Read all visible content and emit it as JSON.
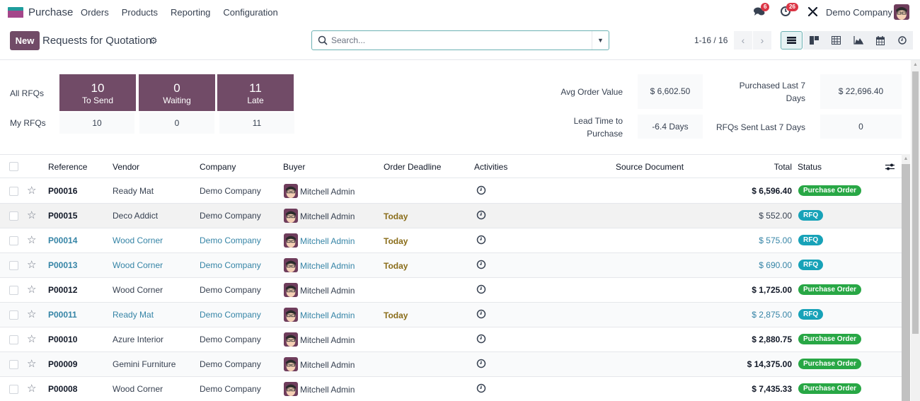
{
  "app": {
    "name": "Purchase",
    "menu": [
      "Orders",
      "Products",
      "Reporting",
      "Configuration"
    ]
  },
  "systray": {
    "messages_count": "6",
    "activities_count": "26",
    "company": "Demo Company",
    "user_avatar": "Mitchell Admin avatar"
  },
  "control": {
    "new_label": "New",
    "title": "Requests for Quotation",
    "search_placeholder": "Search...",
    "pager": "1-16 / 16",
    "views": [
      "list",
      "kanban",
      "pivot",
      "graph",
      "calendar",
      "activity"
    ],
    "active_view": "list"
  },
  "dashboard": {
    "row_labels": [
      "All RFQs",
      "My RFQs"
    ],
    "tiles": [
      {
        "count": "10",
        "label": "To Send",
        "mine": "10"
      },
      {
        "count": "0",
        "label": "Waiting",
        "mine": "0"
      },
      {
        "count": "11",
        "label": "Late",
        "mine": "11"
      }
    ],
    "kpis": {
      "avg_order_value_label": "Avg Order Value",
      "avg_order_value": "$ 6,602.50",
      "lead_time_label_1": "Lead Time to",
      "lead_time_label_2": "Purchase",
      "lead_time": "-6.4 Days",
      "purchased_label_1": "Purchased Last 7",
      "purchased_label_2": "Days",
      "purchased": "$ 22,696.40",
      "rfqs_sent_label": "RFQs Sent Last 7 Days",
      "rfqs_sent": "0"
    }
  },
  "table": {
    "columns": [
      "Reference",
      "Vendor",
      "Company",
      "Buyer",
      "Order Deadline",
      "Activities",
      "Source Document",
      "Total",
      "Status"
    ],
    "rows": [
      {
        "ref": "P00016",
        "vendor": "Ready Mat",
        "company": "Demo Company",
        "buyer": "Mitchell Admin",
        "deadline": "",
        "source": "",
        "total": "$ 6,596.40",
        "status": "Purchase Order"
      },
      {
        "ref": "P00015",
        "vendor": "Deco Addict",
        "company": "Demo Company",
        "buyer": "Mitchell Admin",
        "deadline": "Today",
        "source": "",
        "total": "$ 552.00",
        "status": "RFQ"
      },
      {
        "ref": "P00014",
        "vendor": "Wood Corner",
        "company": "Demo Company",
        "buyer": "Mitchell Admin",
        "deadline": "Today",
        "source": "",
        "total": "$ 575.00",
        "status": "RFQ"
      },
      {
        "ref": "P00013",
        "vendor": "Wood Corner",
        "company": "Demo Company",
        "buyer": "Mitchell Admin",
        "deadline": "Today",
        "source": "",
        "total": "$ 690.00",
        "status": "RFQ"
      },
      {
        "ref": "P00012",
        "vendor": "Wood Corner",
        "company": "Demo Company",
        "buyer": "Mitchell Admin",
        "deadline": "",
        "source": "",
        "total": "$ 1,725.00",
        "status": "Purchase Order"
      },
      {
        "ref": "P00011",
        "vendor": "Ready Mat",
        "company": "Demo Company",
        "buyer": "Mitchell Admin",
        "deadline": "Today",
        "source": "",
        "total": "$ 2,875.00",
        "status": "RFQ"
      },
      {
        "ref": "P00010",
        "vendor": "Azure Interior",
        "company": "Demo Company",
        "buyer": "Mitchell Admin",
        "deadline": "",
        "source": "",
        "total": "$ 2,880.75",
        "status": "Purchase Order"
      },
      {
        "ref": "P00009",
        "vendor": "Gemini Furniture",
        "company": "Demo Company",
        "buyer": "Mitchell Admin",
        "deadline": "",
        "source": "",
        "total": "$ 14,375.00",
        "status": "Purchase Order"
      },
      {
        "ref": "P00008",
        "vendor": "Wood Corner",
        "company": "Demo Company",
        "buyer": "Mitchell Admin",
        "deadline": "",
        "source": "",
        "total": "$ 7,435.33",
        "status": "Purchase Order"
      }
    ]
  },
  "colors": {
    "brand": "#714b67",
    "status_po": "#28a745",
    "status_rfq": "#17a2b8",
    "link": "#3584a6",
    "deadline": "#8a6d1a"
  }
}
